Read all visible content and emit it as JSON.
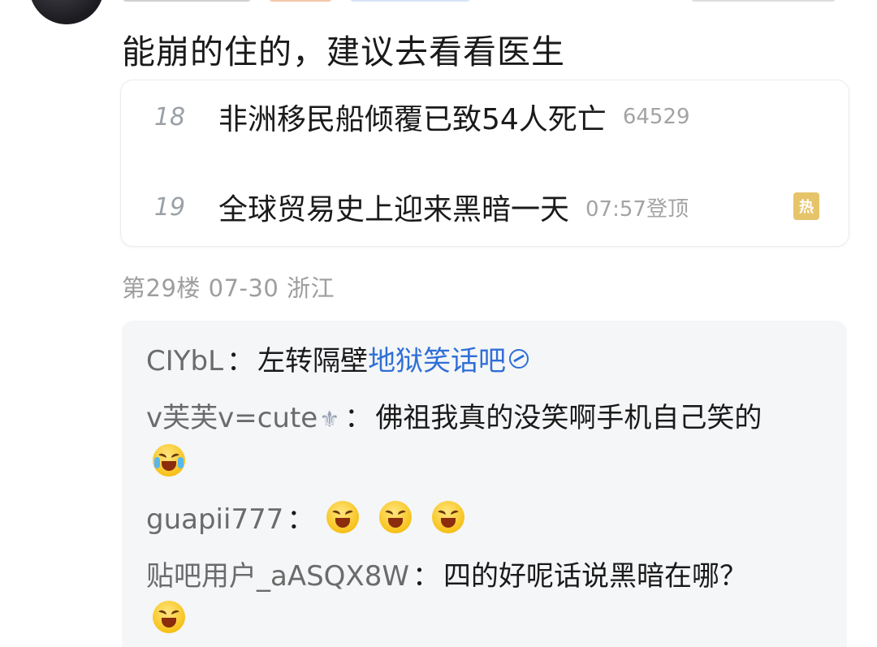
{
  "post": {
    "comment_text": "能崩的住的，建议去看看医生"
  },
  "hot_list": {
    "items": [
      {
        "rank": "18",
        "title": "非洲移民船倾覆已致54人死亡",
        "meta": "64529"
      },
      {
        "rank": "19",
        "title": "全球贸易史上迎来黑暗一天",
        "meta": "07:57登顶",
        "badge": "热"
      }
    ]
  },
  "floor": {
    "info": "第29楼 07-30 浙江"
  },
  "replies": [
    {
      "user": "CIYbL",
      "sep": "：",
      "text": "左转隔壁",
      "link": "地狱笑话吧"
    },
    {
      "user": "v芙芙v=cute",
      "sep": "：",
      "text": "佛祖我真的没笑啊手机自己笑的"
    },
    {
      "user": "guapii777",
      "sep": "：",
      "text": ""
    },
    {
      "user": "贴吧用户_aASQX8W",
      "sep": "：",
      "text": "四的好呢话说黑暗在哪？"
    }
  ],
  "icons": {
    "fleur": "fleur-de-lis-icon",
    "link": "link-icon",
    "emoji_cry": "crying-laughing-emoji",
    "emoji_grin": "grinning-squint-emoji"
  },
  "colors": {
    "link": "#2f6fd6",
    "username": "#6b6b6b",
    "meta_gray": "#9e9e9e",
    "reply_bg": "#f5f6f8",
    "badge": "#e6c46a"
  }
}
